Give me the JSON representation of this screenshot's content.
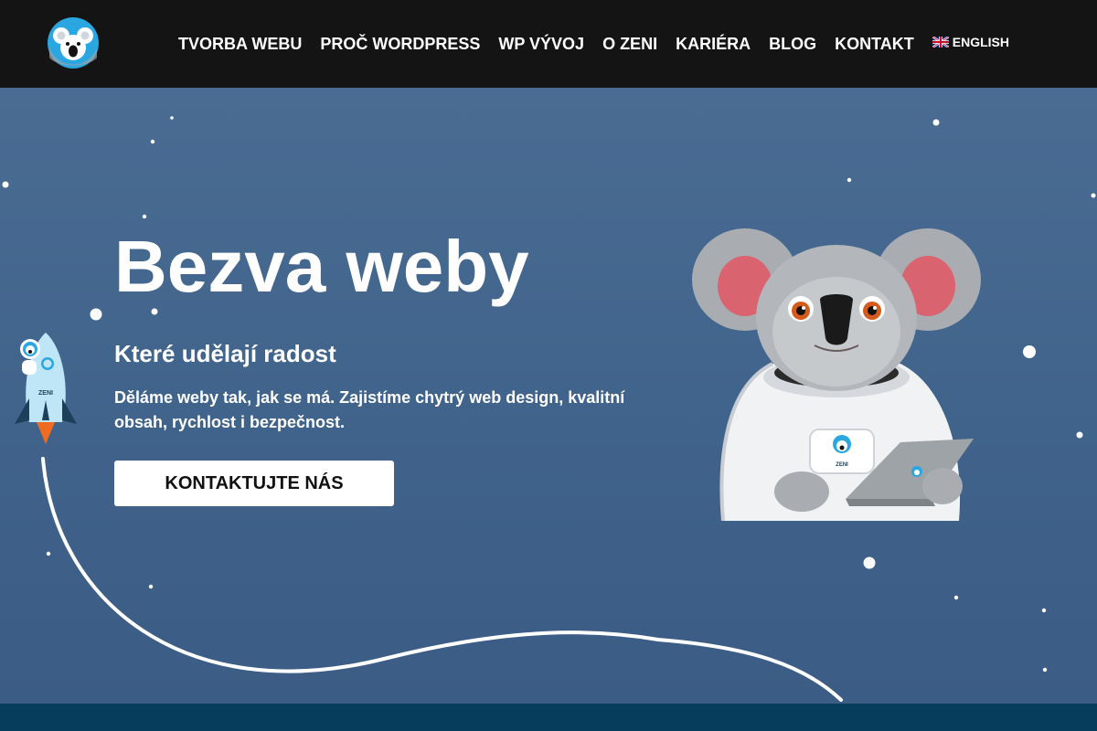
{
  "brand": {
    "logo_icon": "koala-logo-icon",
    "accent": "#2aa7e0"
  },
  "nav": {
    "items": [
      {
        "label": "TVORBA WEBU"
      },
      {
        "label": "PROČ WORDPRESS"
      },
      {
        "label": "WP VÝVOJ"
      },
      {
        "label": "O ZENI"
      },
      {
        "label": "KARIÉRA"
      },
      {
        "label": "BLOG"
      },
      {
        "label": "KONTAKT"
      }
    ],
    "language": {
      "label": "ENGLISH",
      "icon": "uk-flag-icon"
    }
  },
  "hero": {
    "title": "Bezva weby",
    "subtitle": "Které udělají radost",
    "description": "Děláme weby tak, jak se má. Zajistíme chytrý web design, kvalitní obsah, rychlost i bezpečnost.",
    "cta_label": "KONTAKTUJTE NÁS",
    "rocket_text": "ZENI",
    "badge_text": "ZENI"
  },
  "colors": {
    "header_bg": "#141414",
    "hero_bg": "#41648c",
    "footer_bg": "#063d5c"
  }
}
